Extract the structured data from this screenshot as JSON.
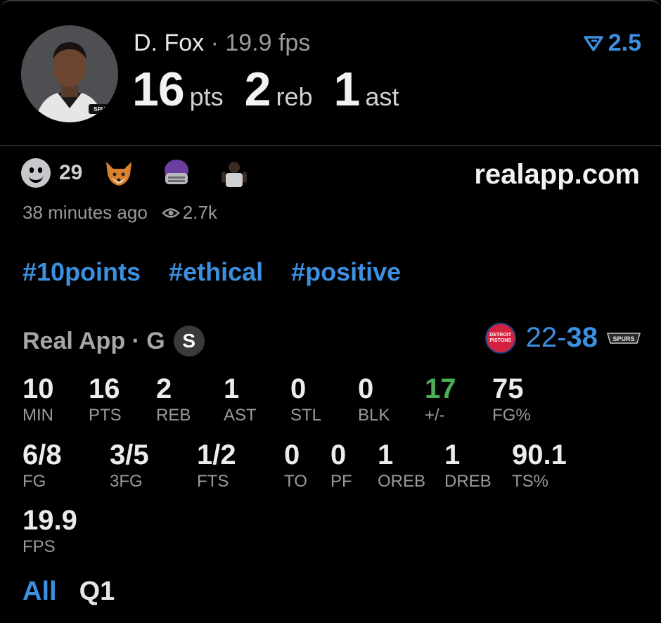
{
  "player": {
    "name": "D. Fox",
    "separator": "·",
    "fps_label": "19.9 fps",
    "boost": "2.5",
    "stats": [
      {
        "value": "16",
        "unit": "pts"
      },
      {
        "value": "2",
        "unit": "reb"
      },
      {
        "value": "1",
        "unit": "ast"
      }
    ]
  },
  "reactions": {
    "count": "29",
    "icons": [
      "smile-icon",
      "fox-icon",
      "helmet-icon",
      "player-avatar-icon"
    ]
  },
  "site": "realapp.com",
  "meta": {
    "time_ago": "38 minutes ago",
    "views": "2.7k"
  },
  "tags": [
    "#10points",
    "#ethical",
    "#positive"
  ],
  "league": {
    "name": "Real App · G",
    "position_badge": "S"
  },
  "score": {
    "left": "22",
    "dash": "-",
    "right": "38"
  },
  "box_row1": [
    {
      "value": "10",
      "label": "MIN"
    },
    {
      "value": "16",
      "label": "PTS"
    },
    {
      "value": "2",
      "label": "REB"
    },
    {
      "value": "1",
      "label": "AST"
    },
    {
      "value": "0",
      "label": "STL"
    },
    {
      "value": "0",
      "label": "BLK"
    },
    {
      "value": "17",
      "label": "+/-"
    },
    {
      "value": "75",
      "label": "FG%"
    }
  ],
  "box_row2": [
    {
      "value": "6/8",
      "label": "FG"
    },
    {
      "value": "3/5",
      "label": "3FG"
    },
    {
      "value": "1/2",
      "label": "FTS"
    },
    {
      "value": "0",
      "label": "TO"
    },
    {
      "value": "0",
      "label": "PF"
    },
    {
      "value": "1",
      "label": "OREB"
    },
    {
      "value": "1",
      "label": "DREB"
    },
    {
      "value": "90.1",
      "label": "TS%"
    }
  ],
  "box_row3": [
    {
      "value": "19.9",
      "label": "FPS"
    }
  ],
  "periods": [
    "All",
    "Q1"
  ],
  "colors": {
    "accent": "#3d8fe0",
    "positive": "#4cae57",
    "background": "#000000"
  }
}
